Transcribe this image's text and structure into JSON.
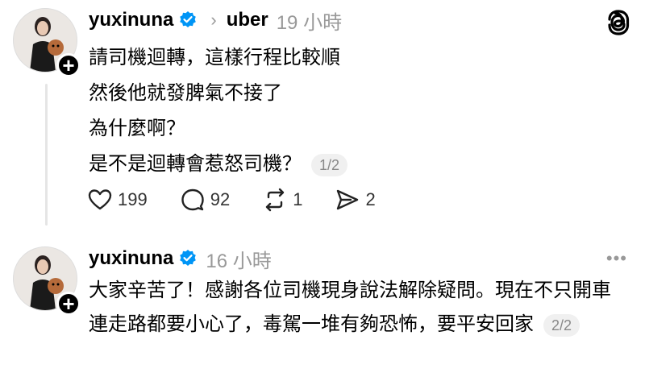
{
  "post1": {
    "username": "yuxinuna",
    "target": "uber",
    "time": "19 小時",
    "lines": [
      "請司機迴轉，這樣行程比較順",
      "然後他就發脾氣不接了",
      "為什麼啊？",
      "是不是迴轉會惹怒司機？"
    ],
    "pager": "1/2",
    "actions": {
      "likes": "199",
      "comments": "92",
      "reposts": "1",
      "shares": "2"
    }
  },
  "post2": {
    "username": "yuxinuna",
    "time": "16 小時",
    "text": "大家辛苦了！感謝各位司機現身說法解除疑問。現在不只開車連走路都要小心了，毒駕一堆有夠恐怖，要平安回家",
    "pager": "2/2"
  },
  "icons": {
    "verified": "verified-badge-icon",
    "threads": "threads-logo-icon",
    "more": "more-icon",
    "like": "heart-icon",
    "comment": "comment-bubble-icon",
    "repost": "repost-icon",
    "share": "send-icon"
  },
  "colors": {
    "verified": "#0095f6",
    "muted": "#999999"
  }
}
